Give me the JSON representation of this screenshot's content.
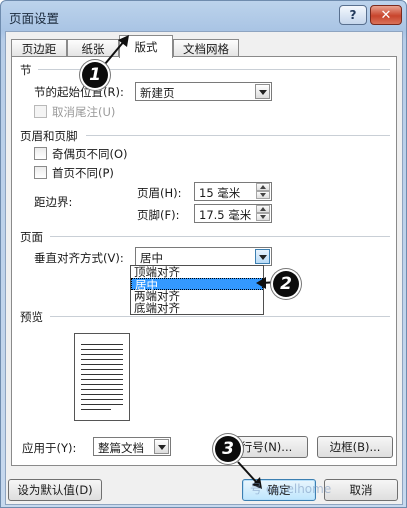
{
  "window": {
    "title": "页面设置",
    "help_label": "?",
    "close_label": "✕"
  },
  "tabs": [
    {
      "label": "页边距",
      "active": false
    },
    {
      "label": "纸张",
      "active": false
    },
    {
      "label": "版式",
      "active": true
    },
    {
      "label": "文档网格",
      "active": false
    }
  ],
  "section_break": {
    "heading": "节",
    "start_label": "节的起始位置(R):",
    "start_value": "新建页",
    "suppress_endnotes_label": "取消尾注(U)",
    "suppress_endnotes_checked": false
  },
  "headers_footers": {
    "heading": "页眉和页脚",
    "odd_even_label": "奇偶页不同(O)",
    "odd_even_checked": false,
    "first_page_label": "首页不同(P)",
    "first_page_checked": false,
    "from_edge_label": "距边界:",
    "header_label": "页眉(H):",
    "header_value": "15 毫米",
    "footer_label": "页脚(F):",
    "footer_value": "17.5 毫米"
  },
  "page": {
    "heading": "页面",
    "vertical_align_label": "垂直对齐方式(V):",
    "vertical_align_value": "居中",
    "options": [
      "顶端对齐",
      "居中",
      "两端对齐",
      "底端对齐"
    ],
    "selected_index": 1
  },
  "preview": {
    "heading": "预览",
    "apply_to_label": "应用于(Y):",
    "apply_to_value": "整篇文档",
    "line_numbers_label": "行号(N)...",
    "borders_label": "边框(B)..."
  },
  "footer": {
    "set_default_label": "设为默认值(D)",
    "ok_label": "确定",
    "cancel_label": "取消"
  },
  "annotations": {
    "step1": "1",
    "step2": "2",
    "step3": "3"
  },
  "watermark": {
    "text": "号 excelhome"
  },
  "colors": {
    "selection": "#3399ff",
    "title_bar": "#b7cde8",
    "close_button": "#c8442c"
  }
}
